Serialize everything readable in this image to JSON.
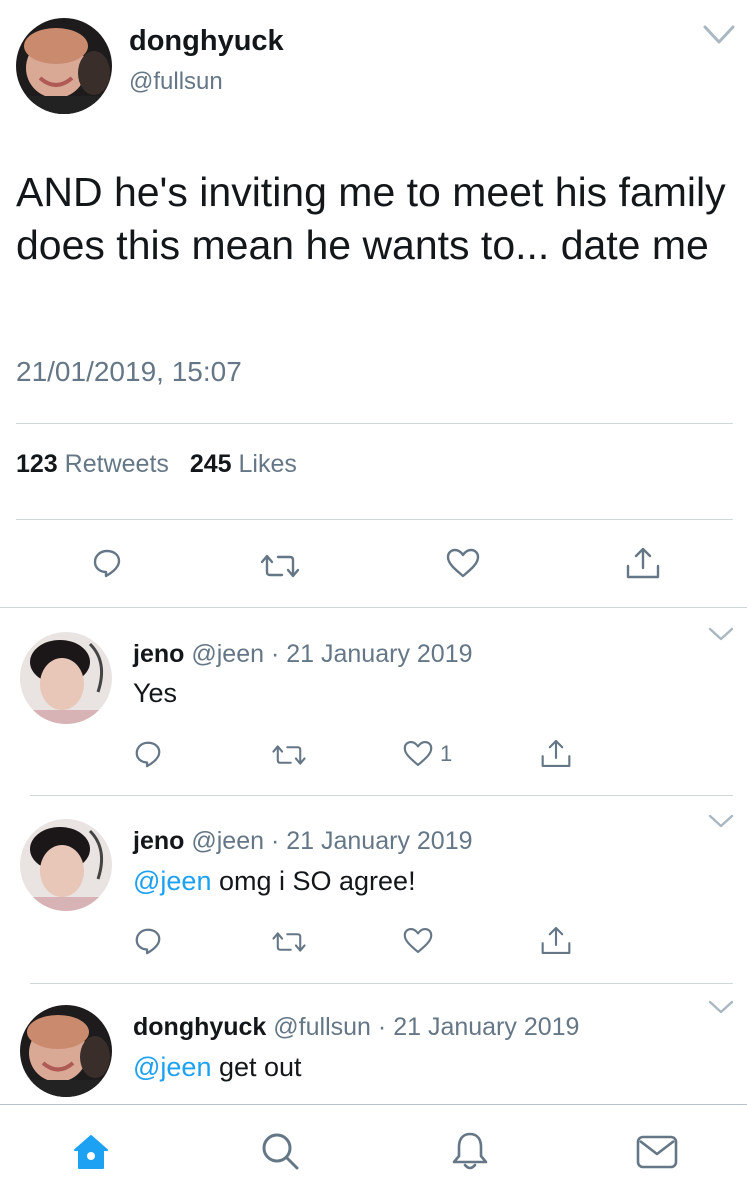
{
  "main_tweet": {
    "name": "donghyuck",
    "handle": "@fullsun",
    "text": "AND he's inviting me to meet his family does this mean he wants to... date me",
    "timestamp": "21/01/2019, 15:07",
    "retweets_count": "123",
    "retweets_label": "Retweets",
    "likes_count": "245",
    "likes_label": "Likes",
    "actions": [
      "reply-icon",
      "retweet-icon",
      "like-icon",
      "share-icon"
    ]
  },
  "replies": [
    {
      "name": "jeno",
      "handle": "@jeen",
      "separator": "·",
      "date": "21 January 2019",
      "mention": "",
      "text": "Yes",
      "like_count": "1"
    },
    {
      "name": "jeno",
      "handle": "@jeen",
      "separator": "·",
      "date": "21 January 2019",
      "mention": "@jeen",
      "text": "omg i SO agree!",
      "like_count": ""
    },
    {
      "name": "donghyuck",
      "handle": "@fullsun",
      "separator": "·",
      "date": "21 January 2019",
      "mention": "@jeen",
      "text": "get out",
      "like_count": ""
    }
  ],
  "tab_bar": {
    "items": [
      "home-icon",
      "search-icon",
      "notifications-icon",
      "messages-icon"
    ],
    "active": "home-icon"
  },
  "colors": {
    "accent": "#1da1f2",
    "text_primary": "#14171a",
    "text_secondary": "#657786",
    "divider": "#cfd6dc"
  }
}
